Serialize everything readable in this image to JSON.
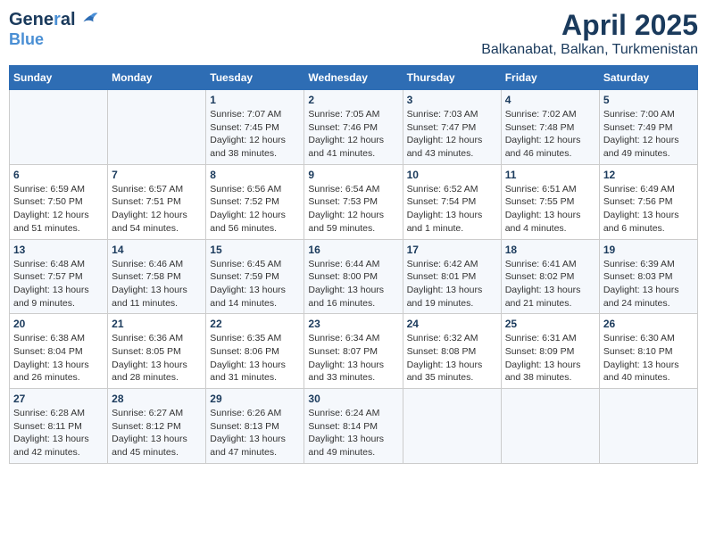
{
  "header": {
    "logo": {
      "general": "General",
      "blue": "Blue"
    },
    "title": "April 2025",
    "location": "Balkanabat, Balkan, Turkmenistan"
  },
  "days_of_week": [
    "Sunday",
    "Monday",
    "Tuesday",
    "Wednesday",
    "Thursday",
    "Friday",
    "Saturday"
  ],
  "weeks": [
    [
      {
        "day": "",
        "info": ""
      },
      {
        "day": "",
        "info": ""
      },
      {
        "day": "1",
        "info": "Sunrise: 7:07 AM\nSunset: 7:45 PM\nDaylight: 12 hours and 38 minutes."
      },
      {
        "day": "2",
        "info": "Sunrise: 7:05 AM\nSunset: 7:46 PM\nDaylight: 12 hours and 41 minutes."
      },
      {
        "day": "3",
        "info": "Sunrise: 7:03 AM\nSunset: 7:47 PM\nDaylight: 12 hours and 43 minutes."
      },
      {
        "day": "4",
        "info": "Sunrise: 7:02 AM\nSunset: 7:48 PM\nDaylight: 12 hours and 46 minutes."
      },
      {
        "day": "5",
        "info": "Sunrise: 7:00 AM\nSunset: 7:49 PM\nDaylight: 12 hours and 49 minutes."
      }
    ],
    [
      {
        "day": "6",
        "info": "Sunrise: 6:59 AM\nSunset: 7:50 PM\nDaylight: 12 hours and 51 minutes."
      },
      {
        "day": "7",
        "info": "Sunrise: 6:57 AM\nSunset: 7:51 PM\nDaylight: 12 hours and 54 minutes."
      },
      {
        "day": "8",
        "info": "Sunrise: 6:56 AM\nSunset: 7:52 PM\nDaylight: 12 hours and 56 minutes."
      },
      {
        "day": "9",
        "info": "Sunrise: 6:54 AM\nSunset: 7:53 PM\nDaylight: 12 hours and 59 minutes."
      },
      {
        "day": "10",
        "info": "Sunrise: 6:52 AM\nSunset: 7:54 PM\nDaylight: 13 hours and 1 minute."
      },
      {
        "day": "11",
        "info": "Sunrise: 6:51 AM\nSunset: 7:55 PM\nDaylight: 13 hours and 4 minutes."
      },
      {
        "day": "12",
        "info": "Sunrise: 6:49 AM\nSunset: 7:56 PM\nDaylight: 13 hours and 6 minutes."
      }
    ],
    [
      {
        "day": "13",
        "info": "Sunrise: 6:48 AM\nSunset: 7:57 PM\nDaylight: 13 hours and 9 minutes."
      },
      {
        "day": "14",
        "info": "Sunrise: 6:46 AM\nSunset: 7:58 PM\nDaylight: 13 hours and 11 minutes."
      },
      {
        "day": "15",
        "info": "Sunrise: 6:45 AM\nSunset: 7:59 PM\nDaylight: 13 hours and 14 minutes."
      },
      {
        "day": "16",
        "info": "Sunrise: 6:44 AM\nSunset: 8:00 PM\nDaylight: 13 hours and 16 minutes."
      },
      {
        "day": "17",
        "info": "Sunrise: 6:42 AM\nSunset: 8:01 PM\nDaylight: 13 hours and 19 minutes."
      },
      {
        "day": "18",
        "info": "Sunrise: 6:41 AM\nSunset: 8:02 PM\nDaylight: 13 hours and 21 minutes."
      },
      {
        "day": "19",
        "info": "Sunrise: 6:39 AM\nSunset: 8:03 PM\nDaylight: 13 hours and 24 minutes."
      }
    ],
    [
      {
        "day": "20",
        "info": "Sunrise: 6:38 AM\nSunset: 8:04 PM\nDaylight: 13 hours and 26 minutes."
      },
      {
        "day": "21",
        "info": "Sunrise: 6:36 AM\nSunset: 8:05 PM\nDaylight: 13 hours and 28 minutes."
      },
      {
        "day": "22",
        "info": "Sunrise: 6:35 AM\nSunset: 8:06 PM\nDaylight: 13 hours and 31 minutes."
      },
      {
        "day": "23",
        "info": "Sunrise: 6:34 AM\nSunset: 8:07 PM\nDaylight: 13 hours and 33 minutes."
      },
      {
        "day": "24",
        "info": "Sunrise: 6:32 AM\nSunset: 8:08 PM\nDaylight: 13 hours and 35 minutes."
      },
      {
        "day": "25",
        "info": "Sunrise: 6:31 AM\nSunset: 8:09 PM\nDaylight: 13 hours and 38 minutes."
      },
      {
        "day": "26",
        "info": "Sunrise: 6:30 AM\nSunset: 8:10 PM\nDaylight: 13 hours and 40 minutes."
      }
    ],
    [
      {
        "day": "27",
        "info": "Sunrise: 6:28 AM\nSunset: 8:11 PM\nDaylight: 13 hours and 42 minutes."
      },
      {
        "day": "28",
        "info": "Sunrise: 6:27 AM\nSunset: 8:12 PM\nDaylight: 13 hours and 45 minutes."
      },
      {
        "day": "29",
        "info": "Sunrise: 6:26 AM\nSunset: 8:13 PM\nDaylight: 13 hours and 47 minutes."
      },
      {
        "day": "30",
        "info": "Sunrise: 6:24 AM\nSunset: 8:14 PM\nDaylight: 13 hours and 49 minutes."
      },
      {
        "day": "",
        "info": ""
      },
      {
        "day": "",
        "info": ""
      },
      {
        "day": "",
        "info": ""
      }
    ]
  ]
}
